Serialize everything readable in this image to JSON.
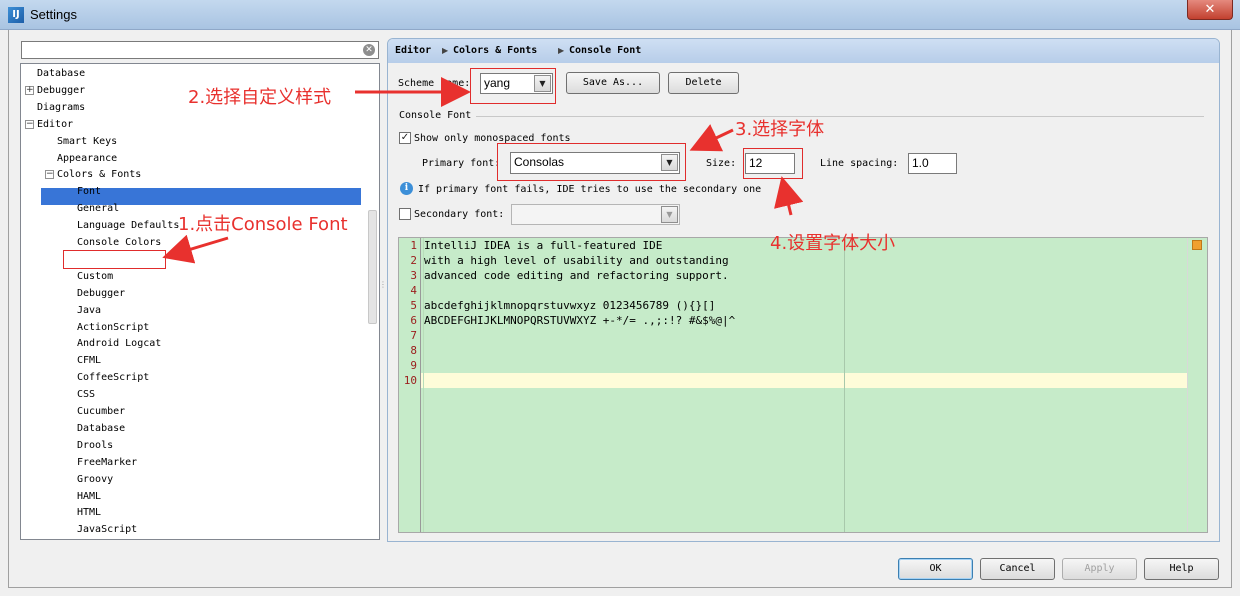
{
  "window": {
    "title": "Settings",
    "app_icon_glyph": "IJ",
    "close_glyph": "✕"
  },
  "search": {
    "value": "",
    "placeholder": "",
    "clear_glyph": "✕"
  },
  "tree": {
    "items": [
      {
        "label": "Database",
        "level": 0,
        "toggle": ""
      },
      {
        "label": "Debugger",
        "level": 0,
        "toggle": "+"
      },
      {
        "label": "Diagrams",
        "level": 0,
        "toggle": ""
      },
      {
        "label": "Editor",
        "level": 0,
        "toggle": "−"
      },
      {
        "label": "Smart Keys",
        "level": 1,
        "toggle": ""
      },
      {
        "label": "Appearance",
        "level": 1,
        "toggle": ""
      },
      {
        "label": "Colors & Fonts",
        "level": 1,
        "toggle": "−"
      },
      {
        "label": "Font",
        "level": 2,
        "toggle": ""
      },
      {
        "label": "General",
        "level": 2,
        "toggle": ""
      },
      {
        "label": "Language Defaults",
        "level": 2,
        "toggle": ""
      },
      {
        "label": "Console Colors",
        "level": 2,
        "toggle": ""
      },
      {
        "label": "Console Font",
        "level": 2,
        "toggle": "",
        "selected": true
      },
      {
        "label": "Custom",
        "level": 2,
        "toggle": ""
      },
      {
        "label": "Debugger",
        "level": 2,
        "toggle": ""
      },
      {
        "label": "Java",
        "level": 2,
        "toggle": ""
      },
      {
        "label": "ActionScript",
        "level": 2,
        "toggle": ""
      },
      {
        "label": "Android Logcat",
        "level": 2,
        "toggle": ""
      },
      {
        "label": "CFML",
        "level": 2,
        "toggle": ""
      },
      {
        "label": "CoffeeScript",
        "level": 2,
        "toggle": ""
      },
      {
        "label": "CSS",
        "level": 2,
        "toggle": ""
      },
      {
        "label": "Cucumber",
        "level": 2,
        "toggle": ""
      },
      {
        "label": "Database",
        "level": 2,
        "toggle": ""
      },
      {
        "label": "Drools",
        "level": 2,
        "toggle": ""
      },
      {
        "label": "FreeMarker",
        "level": 2,
        "toggle": ""
      },
      {
        "label": "Groovy",
        "level": 2,
        "toggle": ""
      },
      {
        "label": "HAML",
        "level": 2,
        "toggle": ""
      },
      {
        "label": "HTML",
        "level": 2,
        "toggle": ""
      },
      {
        "label": "JavaScript",
        "level": 2,
        "toggle": ""
      }
    ]
  },
  "breadcrumb": {
    "items": [
      "Editor",
      "Colors & Fonts",
      "Console Font"
    ],
    "separator": "▶"
  },
  "scheme": {
    "label": "Scheme name:",
    "value": "yang",
    "save_as_label": "Save As...",
    "delete_label": "Delete"
  },
  "console_font": {
    "section_title": "Console Font",
    "monospaced_label": "Show only monospaced fonts",
    "monospaced_checked": true,
    "primary_font_label": "Primary font:",
    "primary_font_value": "Consolas",
    "size_label": "Size:",
    "size_value": "12",
    "line_spacing_label": "Line spacing:",
    "line_spacing_value": "1.0",
    "info_text": "If primary font fails, IDE tries to use the secondary one",
    "info_icon_glyph": "i",
    "secondary_font_label": "Secondary font:",
    "secondary_font_value": "",
    "secondary_checked": false
  },
  "preview": {
    "lines": [
      {
        "no": "1",
        "text": "IntelliJ IDEA is a full-featured IDE"
      },
      {
        "no": "2",
        "text": "with a high level of usability and outstanding"
      },
      {
        "no": "3",
        "text": "advanced code editing and refactoring support."
      },
      {
        "no": "4",
        "text": ""
      },
      {
        "no": "5",
        "text": "abcdefghijklmnopqrstuvwxyz 0123456789 (){}[]"
      },
      {
        "no": "6",
        "text": "ABCDEFGHIJKLMNOPQRSTUVWXYZ +-*/= .,;:!? #&$%@|^"
      },
      {
        "no": "7",
        "text": ""
      },
      {
        "no": "8",
        "text": ""
      },
      {
        "no": "9",
        "text": ""
      },
      {
        "no": "10",
        "text": ""
      }
    ]
  },
  "buttons": {
    "ok": "OK",
    "cancel": "Cancel",
    "apply": "Apply",
    "help": "Help"
  },
  "annotations": {
    "step1": "1.点击Console Font",
    "step2": "2.选择自定义样式",
    "step3": "3.选择字体",
    "step4": "4.设置字体大小"
  },
  "icons": {
    "combo_arrow": "▼",
    "check": "✓"
  }
}
